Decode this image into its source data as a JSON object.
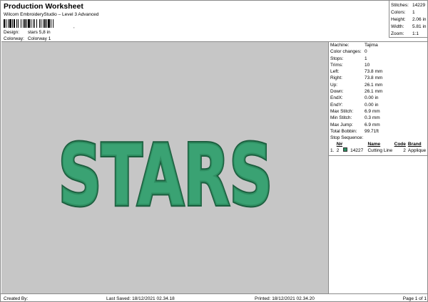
{
  "header": {
    "title": "Production Worksheet",
    "subtitle": "Wilcom EmbroideryStudio – Level 3 Advanced",
    "barcode_tail": ","
  },
  "meta": {
    "design_label": "Design:",
    "design_value": "stars 5,8 in",
    "colorway_label": "Colorway:",
    "colorway_value": "Colorway 1"
  },
  "stats": [
    {
      "label": "Stitches:",
      "value": "14229"
    },
    {
      "label": "Colors:",
      "value": "1"
    },
    {
      "label": "Height:",
      "value": "2.06 in"
    },
    {
      "label": "Width:",
      "value": "5.81 in"
    },
    {
      "label": "Zoom:",
      "value": "1:1"
    }
  ],
  "design": {
    "text": "STARS",
    "background": "#c6c6c6",
    "fill_color": "#3aa273",
    "inner_color": "#2f8f62",
    "outline_color": "#1b5e3e"
  },
  "info": [
    {
      "label": "Machine:",
      "value": "Tajima"
    },
    {
      "label": "Color changes:",
      "value": "0"
    },
    {
      "label": "Stops:",
      "value": "1"
    },
    {
      "label": "Trims:",
      "value": "10"
    },
    {
      "label": "Left:",
      "value": "73.8 mm"
    },
    {
      "label": "Right:",
      "value": "73.8 mm"
    },
    {
      "label": "Up:",
      "value": "26.1 mm"
    },
    {
      "label": "Down:",
      "value": "26.1 mm"
    },
    {
      "label": "EndX:",
      "value": "0.00 in"
    },
    {
      "label": "EndY:",
      "value": "0.00 in"
    },
    {
      "label": "Max Stitch:",
      "value": "6.9 mm"
    },
    {
      "label": "Min Stitch:",
      "value": "0.3 mm"
    },
    {
      "label": "Max Jump:",
      "value": "6.9 mm"
    },
    {
      "label": "Total Bobbin:",
      "value": "99.71ft"
    }
  ],
  "stop_sequence": {
    "title": "Stop Sequence:",
    "headers": {
      "n": "N#",
      "name": "Name",
      "code": "Code",
      "brand": "Brand"
    },
    "rows": [
      {
        "idx": "1.",
        "n": "2",
        "color": "#2f8f62",
        "stitches": "14227",
        "name": "Cutting Line",
        "code": "2",
        "brand": "Applique"
      }
    ]
  },
  "footer": {
    "created": "Created By:",
    "saved": "Last Saved: 18/12/2021 02.34.18",
    "printed": "Printed: 18/12/2021 02.34.20",
    "page": "Page 1 of 1"
  }
}
